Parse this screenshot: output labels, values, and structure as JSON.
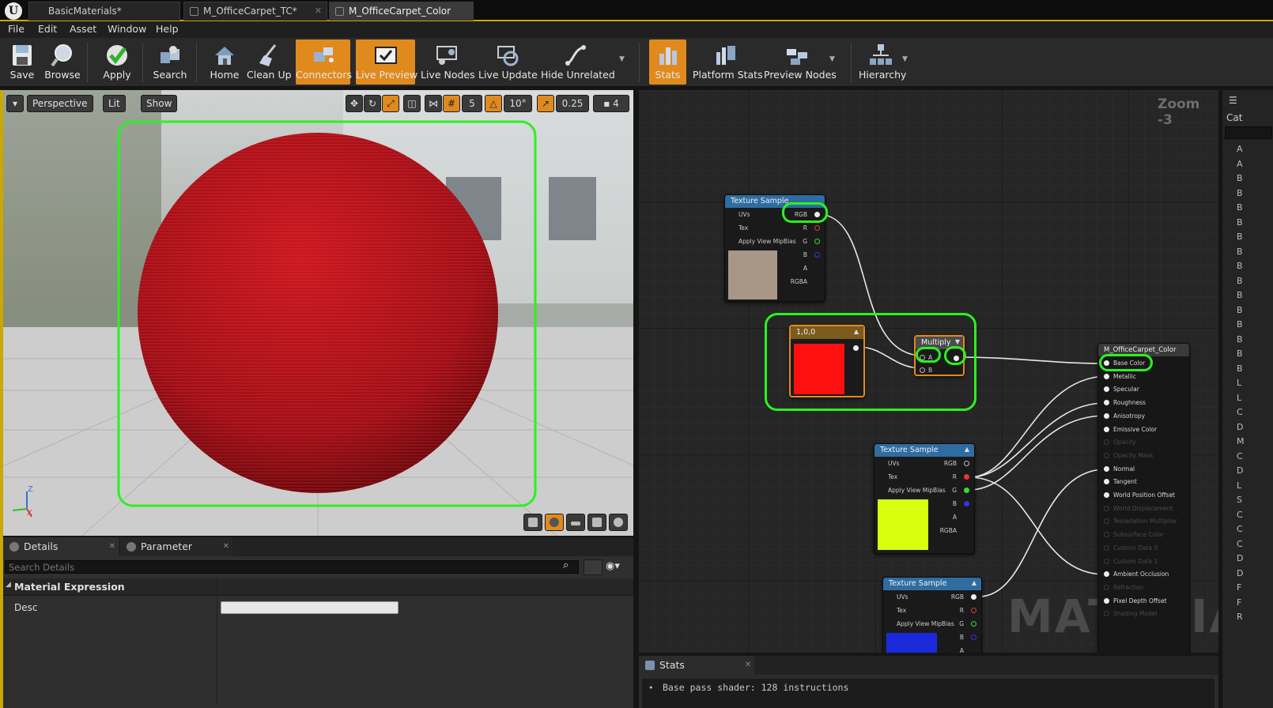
{
  "tabs": [
    {
      "label": "BasicMaterials*",
      "active": false
    },
    {
      "label": "M_OfficeCarpet_TC*",
      "active": false
    },
    {
      "label": "M_OfficeCarpet_Color",
      "active": true
    }
  ],
  "menu": [
    "File",
    "Edit",
    "Asset",
    "Window",
    "Help"
  ],
  "toolbar": {
    "buttons": [
      {
        "label": "Save",
        "icon": "save-icon",
        "on": false
      },
      {
        "label": "Browse",
        "icon": "browse-icon",
        "on": false
      },
      {
        "label": "Apply",
        "icon": "apply-icon",
        "on": false
      },
      {
        "label": "Search",
        "icon": "search-icon",
        "on": false
      },
      {
        "label": "Home",
        "icon": "home-icon",
        "on": false
      },
      {
        "label": "Clean Up",
        "icon": "cleanup-icon",
        "on": false
      },
      {
        "label": "Connectors",
        "icon": "connectors-icon",
        "on": true
      },
      {
        "label": "Live Preview",
        "icon": "live-preview-icon",
        "on": true
      },
      {
        "label": "Live Nodes",
        "icon": "live-nodes-icon",
        "on": false
      },
      {
        "label": "Live Update",
        "icon": "live-update-icon",
        "on": false
      },
      {
        "label": "Hide Unrelated",
        "icon": "hide-unrelated-icon",
        "on": false
      },
      {
        "label": "Stats",
        "icon": "stats-icon",
        "on": true
      },
      {
        "label": "Platform Stats",
        "icon": "platform-stats-icon",
        "on": false
      },
      {
        "label": "Preview Nodes",
        "icon": "preview-nodes-icon",
        "on": false
      },
      {
        "label": "Hierarchy",
        "icon": "hierarchy-icon",
        "on": false
      }
    ]
  },
  "viewport": {
    "perspective": "Perspective",
    "lit": "Lit",
    "show": "Show",
    "grid_snap": "5",
    "rotation_snap": "10°",
    "scale_snap": "0.25",
    "camera_speed": "4",
    "axis_z": "Z",
    "axis_x": "X"
  },
  "details": {
    "tab_details": "Details",
    "tab_params": "Parameter Defaults",
    "search_placeholder": "Search Details",
    "section": "Material Expression",
    "desc_label": "Desc",
    "desc_value": ""
  },
  "graph": {
    "zoom": "Zoom -3",
    "watermark": "MATERIAL",
    "texture_sample_title": "Texture Sample",
    "ts_inputs": [
      "UVs",
      "Tex",
      "Apply View MipBias"
    ],
    "ts_outputs": [
      "RGB",
      "R",
      "G",
      "B",
      "A",
      "RGBA"
    ],
    "constant_title": "1,0,0",
    "multiply_title": "Multiply",
    "multiply_a": "A",
    "multiply_b": "B",
    "result_title": "M_OfficeCarpet_Color",
    "result_pins": [
      {
        "label": "Base Color",
        "enabled": true
      },
      {
        "label": "Metallic",
        "enabled": true
      },
      {
        "label": "Specular",
        "enabled": true
      },
      {
        "label": "Roughness",
        "enabled": true
      },
      {
        "label": "Anisotropy",
        "enabled": true
      },
      {
        "label": "Emissive Color",
        "enabled": true
      },
      {
        "label": "Opacity",
        "enabled": false
      },
      {
        "label": "Opacity Mask",
        "enabled": false
      },
      {
        "label": "Normal",
        "enabled": true
      },
      {
        "label": "Tangent",
        "enabled": true
      },
      {
        "label": "World Position Offset",
        "enabled": true
      },
      {
        "label": "World Displacement",
        "enabled": false
      },
      {
        "label": "Tessellation Multiplier",
        "enabled": false
      },
      {
        "label": "Subsurface Color",
        "enabled": false
      },
      {
        "label": "Custom Data 0",
        "enabled": false
      },
      {
        "label": "Custom Data 1",
        "enabled": false
      },
      {
        "label": "Ambient Occlusion",
        "enabled": true
      },
      {
        "label": "Refraction",
        "enabled": false
      },
      {
        "label": "Pixel Depth Offset",
        "enabled": true
      },
      {
        "label": "Shading Model",
        "enabled": false
      }
    ]
  },
  "stats": {
    "tab": "Stats",
    "line1": "Base pass shader: 128 instructions"
  },
  "right_panel": {
    "title": "Cat",
    "letters": [
      "A",
      "A",
      "B",
      "B",
      "B",
      "B",
      "B",
      "B",
      "B",
      "B",
      "B",
      "B",
      "B",
      "B",
      "B",
      "B",
      "L",
      "L",
      "C",
      "D",
      "M",
      "C",
      "D",
      "L",
      "S",
      "C",
      "C",
      "C",
      "D",
      "D",
      "F",
      "F",
      "R"
    ]
  },
  "colors": {
    "accent_orange": "#e08a1e",
    "highlight_green": "#2bf21e",
    "constant_red": "#ff1010",
    "texture_yellow": "#d8ff10",
    "texture_blue": "#1a2adb"
  }
}
